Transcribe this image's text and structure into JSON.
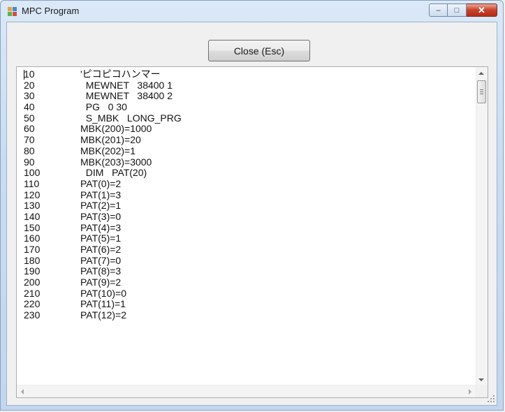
{
  "window": {
    "title": "MPC Program"
  },
  "buttons": {
    "close_label": "Close (Esc)"
  },
  "caption": {
    "min": "–",
    "max": "□",
    "close": "✕"
  },
  "program": {
    "lines": [
      {
        "n": "10",
        "code": "'ピコピコハンマー"
      },
      {
        "n": "20",
        "code": "  MEWNET   38400 1"
      },
      {
        "n": "30",
        "code": "  MEWNET   38400 2"
      },
      {
        "n": "40",
        "code": "  PG   0 30"
      },
      {
        "n": "50",
        "code": "  S_MBK   LONG_PRG"
      },
      {
        "n": "60",
        "code": "MBK(200)=1000"
      },
      {
        "n": "70",
        "code": "MBK(201)=20"
      },
      {
        "n": "80",
        "code": "MBK(202)=1"
      },
      {
        "n": "90",
        "code": "MBK(203)=3000"
      },
      {
        "n": "100",
        "code": "  DIM   PAT(20)"
      },
      {
        "n": "110",
        "code": "PAT(0)=2"
      },
      {
        "n": "120",
        "code": "PAT(1)=3"
      },
      {
        "n": "130",
        "code": "PAT(2)=1"
      },
      {
        "n": "140",
        "code": "PAT(3)=0"
      },
      {
        "n": "150",
        "code": "PAT(4)=3"
      },
      {
        "n": "160",
        "code": "PAT(5)=1"
      },
      {
        "n": "170",
        "code": "PAT(6)=2"
      },
      {
        "n": "180",
        "code": "PAT(7)=0"
      },
      {
        "n": "190",
        "code": "PAT(8)=3"
      },
      {
        "n": "200",
        "code": "PAT(9)=2"
      },
      {
        "n": "210",
        "code": "PAT(10)=0"
      },
      {
        "n": "220",
        "code": "PAT(11)=1"
      },
      {
        "n": "230",
        "code": "PAT(12)=2"
      }
    ]
  },
  "icons": {
    "app": "app-icon",
    "minimize": "minimize-icon",
    "maximize": "maximize-icon",
    "close": "close-icon"
  }
}
